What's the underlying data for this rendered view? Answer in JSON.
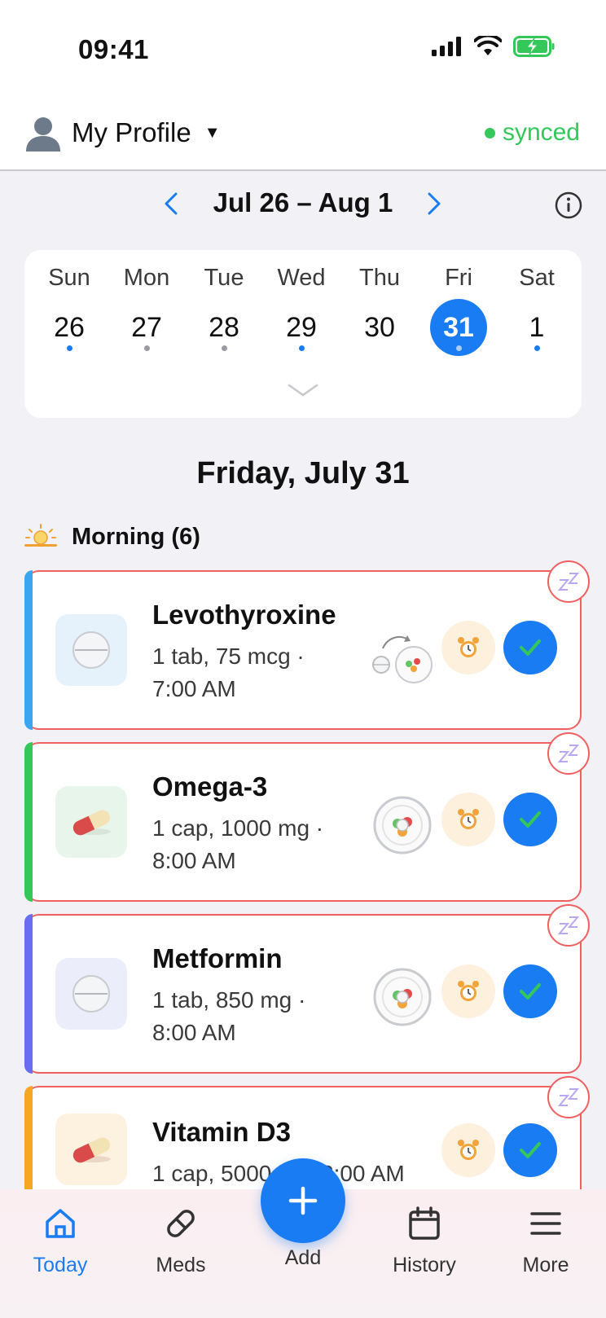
{
  "status_bar": {
    "time": "09:41"
  },
  "header": {
    "profile_label": "My Profile",
    "sync_status": "synced"
  },
  "week": {
    "range": "Jul 26 – Aug 1",
    "days": [
      {
        "dow": "Sun",
        "date": "26",
        "dot": "#1a7cf2"
      },
      {
        "dow": "Mon",
        "date": "27",
        "dot": "#9a9aa0"
      },
      {
        "dow": "Tue",
        "date": "28",
        "dot": "#9a9aa0"
      },
      {
        "dow": "Wed",
        "date": "29",
        "dot": "#1a7cf2"
      },
      {
        "dow": "Thu",
        "date": "30",
        "dot": ""
      },
      {
        "dow": "Fri",
        "date": "31",
        "dot": "#a9cdfb",
        "selected": true
      },
      {
        "dow": "Sat",
        "date": "1",
        "dot": "#1a7cf2"
      }
    ]
  },
  "day_title": "Friday, July 31",
  "section": {
    "label": "Morning (6)",
    "icon": "sunrise-icon"
  },
  "meds": [
    {
      "name": "Levothyroxine",
      "dose_line1": "1 tab, 75 mcg ·",
      "dose_line2": "7:00 AM",
      "color": "#3aa6f0",
      "thumb_bg": "#e6f2fb",
      "form": "tablet",
      "schedule_icon": "before-meal-icon"
    },
    {
      "name": "Omega-3",
      "dose_line1": "1 cap, 1000 mg ·",
      "dose_line2": "8:00 AM",
      "color": "#34c759",
      "thumb_bg": "#e7f5ea",
      "form": "capsule",
      "schedule_icon": "with-meal-icon"
    },
    {
      "name": "Metformin",
      "dose_line1": "1 tab, 850 mg ·",
      "dose_line2": "8:00 AM",
      "color": "#6b6cf2",
      "thumb_bg": "#ecedfb",
      "form": "tablet",
      "schedule_icon": "with-meal-icon"
    },
    {
      "name": "Vitamin D3",
      "dose_line1": "1 cap, 5000 IU · 8:00 AM",
      "dose_line2": "",
      "color": "#f5a623",
      "thumb_bg": "#fdf1e0",
      "form": "capsule",
      "schedule_icon": ""
    }
  ],
  "tabs": [
    {
      "label": "Today",
      "icon": "home-icon",
      "active": true
    },
    {
      "label": "Meds",
      "icon": "pill-icon"
    },
    {
      "label": "Add",
      "icon": "plus-icon"
    },
    {
      "label": "History",
      "icon": "calendar-icon"
    },
    {
      "label": "More",
      "icon": "menu-icon"
    }
  ],
  "colors": {
    "accent": "#1a7cf2",
    "synced": "#34c759",
    "overdue_border": "#f06060"
  }
}
